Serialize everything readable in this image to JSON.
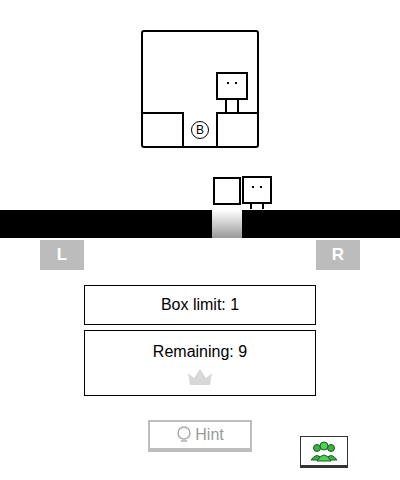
{
  "preview": {
    "button_label": "B"
  },
  "shoulder_buttons": [
    {
      "label": "L"
    },
    {
      "label": "R"
    }
  ],
  "box_limit": "Box limit: 1",
  "remaining": {
    "label": "Remaining: 9",
    "crown_earned": false
  },
  "hint": {
    "label": "Hint",
    "disabled": true
  }
}
